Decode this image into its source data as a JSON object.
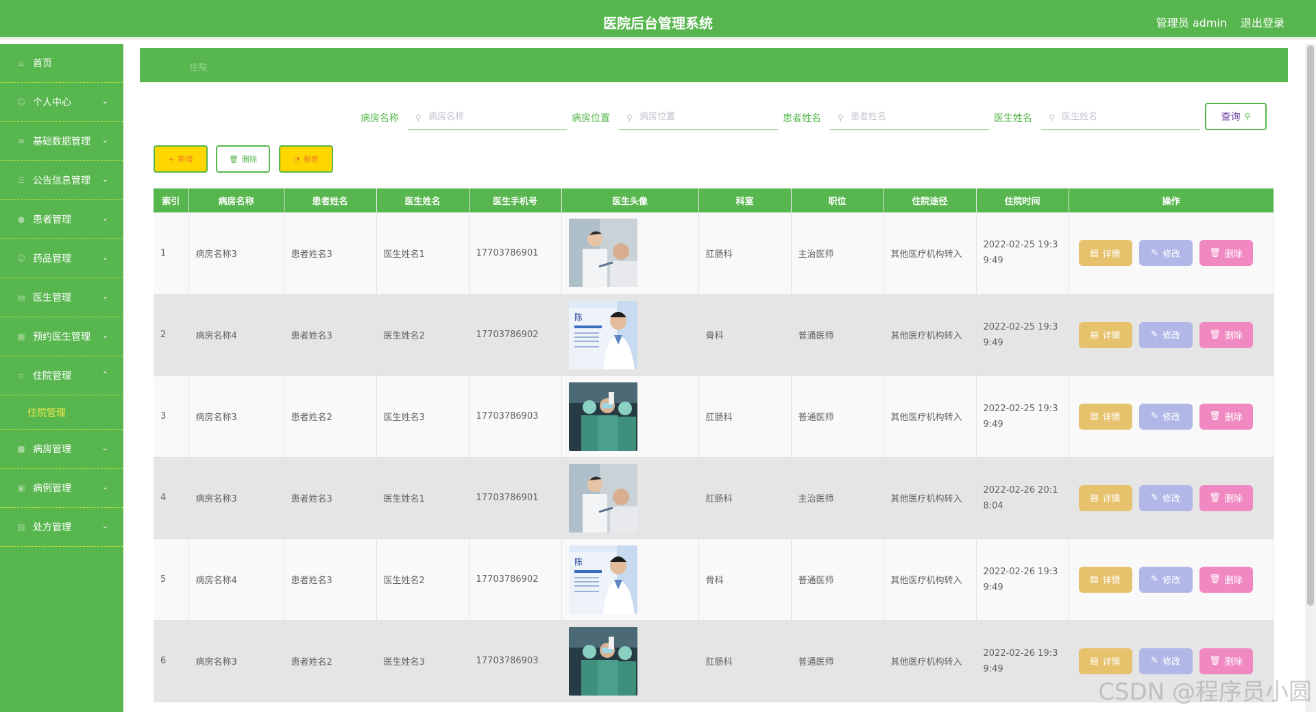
{
  "header": {
    "title": "医院后台管理系统",
    "user": "管理员 admin",
    "logout": "退出登录"
  },
  "sidebar": {
    "items": [
      {
        "label": "首页",
        "icon": "home-icon",
        "expandable": false
      },
      {
        "label": "个人中心",
        "icon": "user-icon",
        "expandable": true
      },
      {
        "label": "基础数据管理",
        "icon": "list-icon",
        "expandable": true
      },
      {
        "label": "公告信息管理",
        "icon": "menu-icon",
        "expandable": true
      },
      {
        "label": "患者管理",
        "icon": "patient-icon",
        "expandable": true
      },
      {
        "label": "药品管理",
        "icon": "user-icon",
        "expandable": true
      },
      {
        "label": "医生管理",
        "icon": "chart-icon",
        "expandable": true
      },
      {
        "label": "预约医生管理",
        "icon": "calendar-icon",
        "expandable": true
      },
      {
        "label": "住院管理",
        "icon": "bed-icon",
        "expandable": true,
        "open": true
      },
      {
        "label": "病房管理",
        "icon": "ward-icon",
        "expandable": true
      },
      {
        "label": "病例管理",
        "icon": "case-icon",
        "expandable": true
      },
      {
        "label": "处方管理",
        "icon": "prescription-icon",
        "expandable": true
      }
    ],
    "active_sub": "住院管理"
  },
  "breadcrumb": "住院",
  "search": {
    "fields": [
      {
        "label": "病房名称",
        "placeholder": "病房名称"
      },
      {
        "label": "病房位置",
        "placeholder": "病房位置"
      },
      {
        "label": "患者姓名",
        "placeholder": "患者姓名"
      },
      {
        "label": "医生姓名",
        "placeholder": "医生姓名"
      }
    ],
    "button": "查询"
  },
  "actions": {
    "add": "新增",
    "delete": "删除",
    "report": "报表"
  },
  "table": {
    "columns": [
      "索引",
      "病房名称",
      "患者姓名",
      "医生姓名",
      "医生手机号",
      "医生头像",
      "科室",
      "职位",
      "住院途径",
      "住院时间",
      "操作"
    ],
    "rows": [
      {
        "index": "1",
        "ward": "病房名称3",
        "patient": "患者姓名3",
        "doctor": "医生姓名1",
        "phone": "17703786901",
        "avatar": "doctor-photo-a",
        "dept": "肛肠科",
        "title": "主治医师",
        "route": "其他医疗机构转入",
        "time_1": "2022-02-25 19:3",
        "time_2": "9:49"
      },
      {
        "index": "2",
        "ward": "病房名称4",
        "patient": "患者姓名3",
        "doctor": "医生姓名2",
        "phone": "17703786902",
        "avatar": "doctor-photo-b",
        "dept": "骨科",
        "title": "普通医师",
        "route": "其他医疗机构转入",
        "time_1": "2022-02-25 19:3",
        "time_2": "9:49"
      },
      {
        "index": "3",
        "ward": "病房名称3",
        "patient": "患者姓名2",
        "doctor": "医生姓名3",
        "phone": "17703786903",
        "avatar": "doctor-photo-c",
        "dept": "肛肠科",
        "title": "普通医师",
        "route": "其他医疗机构转入",
        "time_1": "2022-02-25 19:3",
        "time_2": "9:49"
      },
      {
        "index": "4",
        "ward": "病房名称3",
        "patient": "患者姓名3",
        "doctor": "医生姓名1",
        "phone": "17703786901",
        "avatar": "doctor-photo-a",
        "dept": "肛肠科",
        "title": "主治医师",
        "route": "其他医疗机构转入",
        "time_1": "2022-02-26 20:1",
        "time_2": "8:04"
      },
      {
        "index": "5",
        "ward": "病房名称4",
        "patient": "患者姓名3",
        "doctor": "医生姓名2",
        "phone": "17703786902",
        "avatar": "doctor-photo-b",
        "dept": "骨科",
        "title": "普通医师",
        "route": "其他医疗机构转入",
        "time_1": "2022-02-26 19:3",
        "time_2": "9:49"
      },
      {
        "index": "6",
        "ward": "病房名称3",
        "patient": "患者姓名2",
        "doctor": "医生姓名3",
        "phone": "17703786903",
        "avatar": "doctor-photo-c",
        "dept": "肛肠科",
        "title": "普通医师",
        "route": "其他医疗机构转入",
        "time_1": "2022-02-26 19:3",
        "time_2": "9:49"
      }
    ],
    "op_labels": {
      "detail": "详情",
      "edit": "修改",
      "delete": "删除"
    }
  },
  "watermark": "CSDN @程序员小圆",
  "colors": {
    "primary": "#57b64d",
    "yellow": "#ffd700",
    "detail": "#e7c26d",
    "edit": "#b1b8e8",
    "delete": "#f089c1"
  }
}
